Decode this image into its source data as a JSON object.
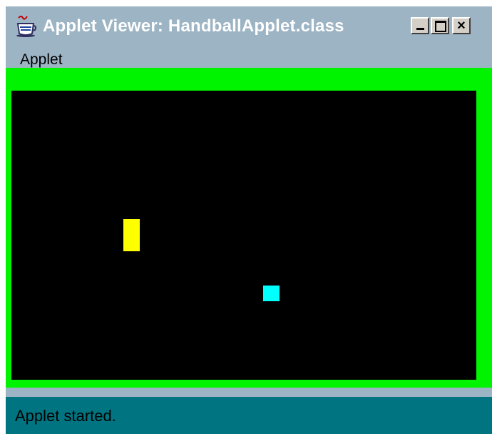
{
  "window": {
    "title": "Applet Viewer: HandballApplet.class",
    "controls": {
      "minimize": "_",
      "maximize": "□",
      "close": "×"
    }
  },
  "menubar": {
    "items": [
      {
        "label": "Applet"
      }
    ]
  },
  "game": {
    "border_color": "#00f400",
    "court_color": "#000000",
    "paddle_color": "#ffff00",
    "ball_color": "#00ffff"
  },
  "status": {
    "text": "Applet started."
  },
  "icons": {
    "app": "java-coffee-cup-icon"
  }
}
